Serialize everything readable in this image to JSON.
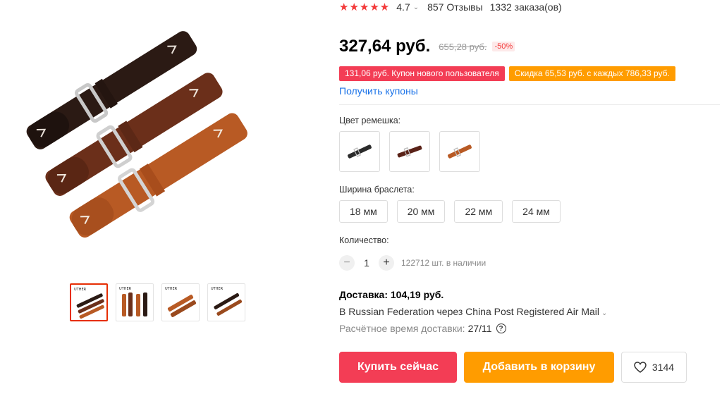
{
  "rating": {
    "stars": "★★★★★",
    "value": "4.7",
    "reviews": "857 Отзывы",
    "orders": "1332 заказа(ов)"
  },
  "price": {
    "current": "327,64 руб.",
    "old": "655,28 руб.",
    "discount": "-50%"
  },
  "coupons": {
    "new_user": "131,06 руб. Купон нового пользователя",
    "store": "Скидка 65,53 руб. с каждых 786,33 руб.",
    "get_link": "Получить купоны"
  },
  "color": {
    "label": "Цвет ремешка:"
  },
  "width": {
    "label": "Ширина браслета:",
    "options": [
      "18 мм",
      "20 мм",
      "22 мм",
      "24 мм"
    ]
  },
  "quantity": {
    "label": "Количество:",
    "minus": "−",
    "plus": "+",
    "value": "1",
    "stock": "122712 шт. в наличии"
  },
  "delivery": {
    "title": "Доставка: 104,19 руб.",
    "route": "В Russian Federation через China Post Registered Air Mail",
    "estimate_label": "Расчётное время доставки:",
    "estimate_date": "27/11",
    "help": "?"
  },
  "actions": {
    "buy": "Купить сейчас",
    "cart": "Добавить в корзину",
    "wishlist_count": "3144"
  },
  "thumbnails": {
    "logo": "UTHER"
  },
  "colors": {
    "red": "#f33d55",
    "orange": "#ff9c00",
    "link": "#1a72e8",
    "star": "#f33a3a"
  }
}
